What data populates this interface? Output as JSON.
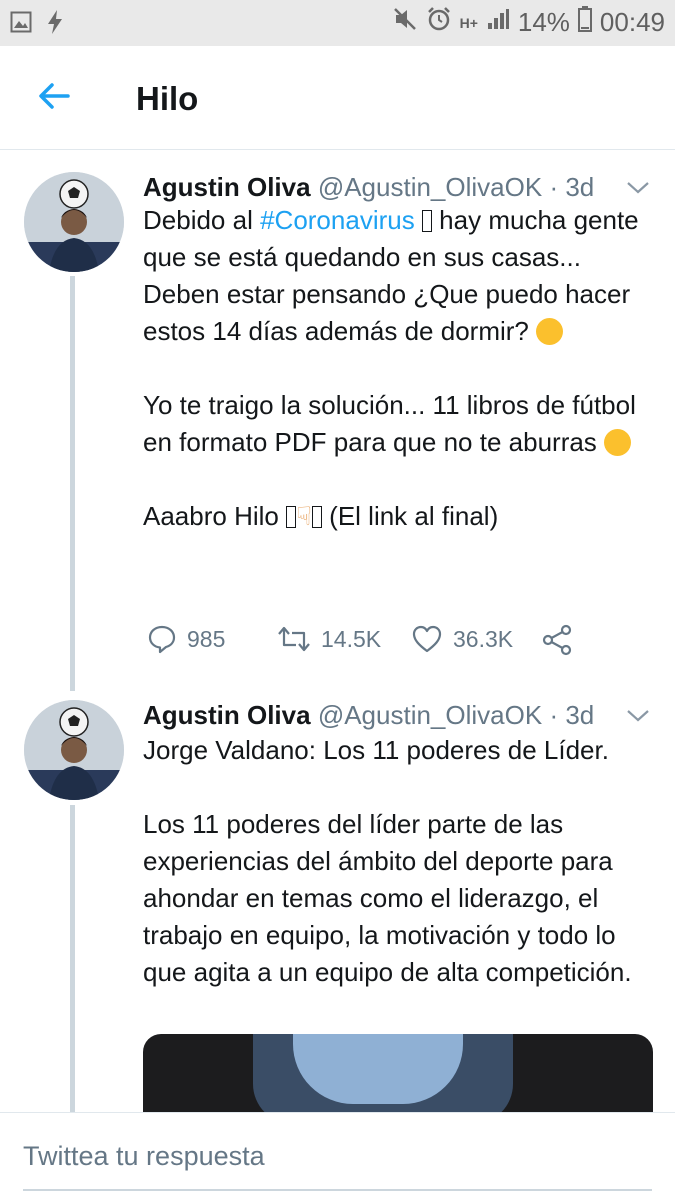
{
  "status_bar": {
    "battery": "14%",
    "time": "00:49",
    "network": "H+",
    "icons": [
      "image-icon",
      "flash-icon",
      "mute-icon",
      "alarm-icon",
      "signal-icon",
      "battery-icon"
    ]
  },
  "header": {
    "title": "Hilo",
    "back_icon": "arrow-left-icon"
  },
  "colors": {
    "accent": "#1da1f2",
    "text": "#14171a",
    "muted": "#657786",
    "status_bar_bg": "#e9e9e9"
  },
  "tweets": [
    {
      "name": "Agustin Oliva",
      "handle": "@Agustin_OlivaOK",
      "time": "· 3d",
      "text": {
        "p1_pre": "Debido al ",
        "hashtag": "#Coronavirus",
        "p1_post": " hay mucha gente que se está quedando en sus casas... Deben estar pensando ¿Que puedo hacer estos 14 días además de dormir?",
        "p2": "Yo te traigo la solución... 11 libros de fútbol en formato PDF para que no te aburras",
        "p3_pre": "Aaabro Hilo",
        "p3_post": "(El link al final)"
      },
      "replies": "985",
      "retweets": "14.5K",
      "likes": "36.3K"
    },
    {
      "name": "Agustin Oliva",
      "handle": "@Agustin_OlivaOK",
      "time": "· 3d",
      "text": {
        "p1": "Jorge Valdano: Los 11 poderes de Líder.",
        "p2": "Los 11 poderes del líder parte de las experiencias del ámbito del deporte para ahondar en temas como el liderazgo, el trabajo en equipo, la motivación y todo lo que agita a un equipo de alta competición."
      }
    }
  ],
  "reply_bar": {
    "placeholder": "Twittea tu respuesta"
  }
}
